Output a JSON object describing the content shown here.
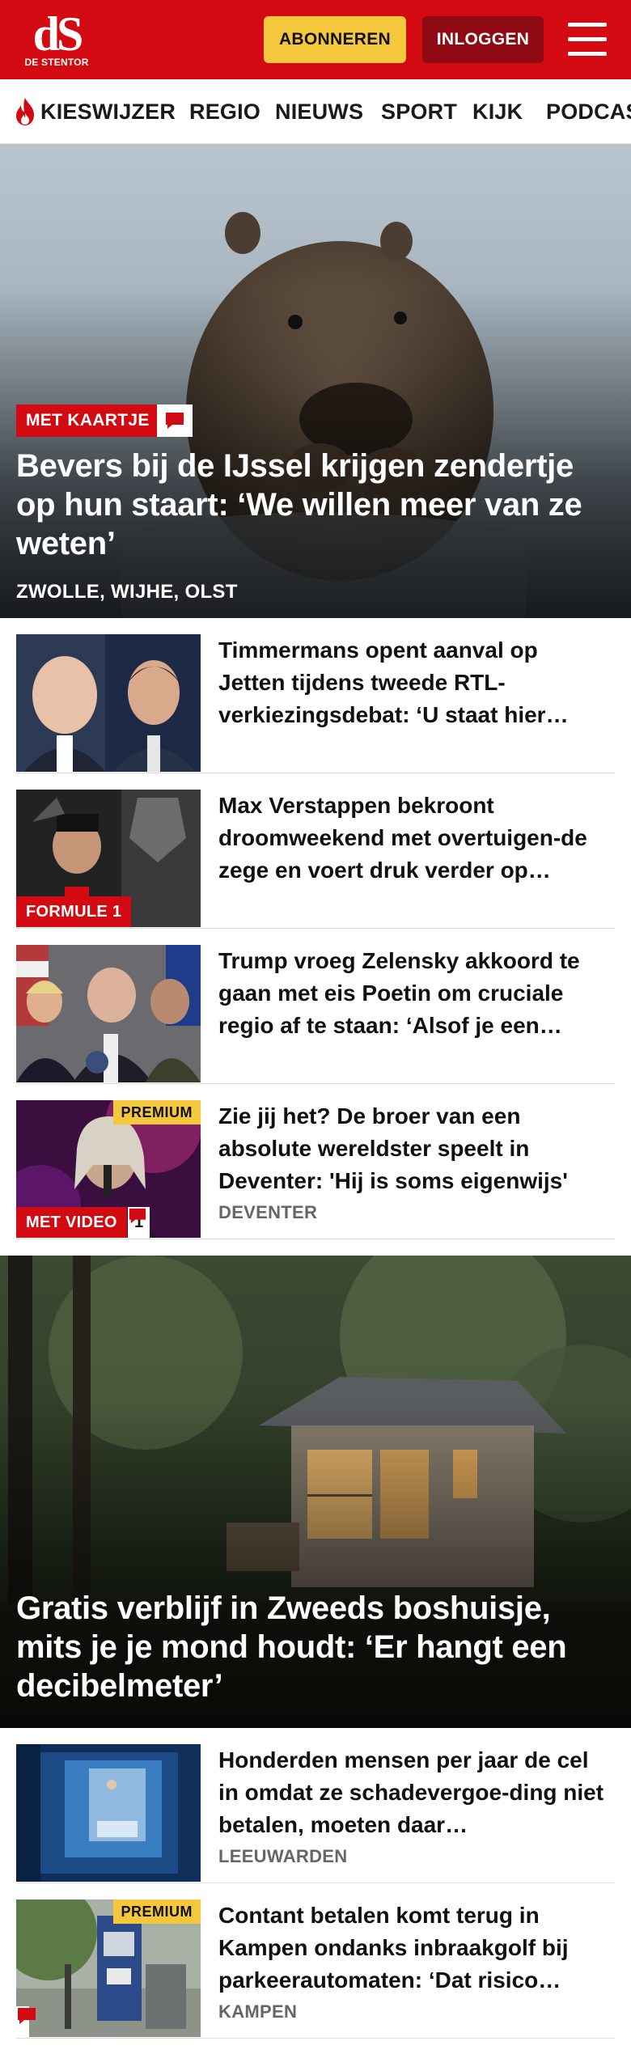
{
  "header": {
    "logo_mark": "dS",
    "logo_text": "DE STENTOR",
    "subscribe_label": "ABONNEREN",
    "login_label": "INLOGGEN",
    "menu_icon": "hamburger-menu-icon"
  },
  "nav": {
    "items": [
      {
        "label": "KIESWIJZER",
        "icon": "flame-icon"
      },
      {
        "label": "REGIO"
      },
      {
        "label": "NIEUWS"
      },
      {
        "label": "SPORT"
      },
      {
        "label": "KIJK"
      },
      {
        "label": "PODCAS"
      }
    ]
  },
  "hero1": {
    "tag": "MET KAARTJE",
    "comment_icon": "comment-icon",
    "title": "Bevers bij de IJssel krijgen zendertje op hun staart: ‘We willen meer van ze weten’",
    "location": "ZWOLLE, WIJHE, OLST"
  },
  "articles1": [
    {
      "title": "Timmermans opent aanval op Jetten tijdens tweede RTL-verkiezingsdebat: ‘U staat hier…"
    },
    {
      "title": "Max Verstappen bekroont droomweekend met overtuigen-de zege en voert druk verder op…",
      "tag": "FORMULE 1"
    },
    {
      "title": "Trump vroeg Zelensky akkoord te gaan met eis Poetin om cruciale regio af te staan: ‘Alsof je een…"
    },
    {
      "title": "Zie jij het? De broer van een absolute wereldster speelt in Deventer: 'Hij is soms eigenwijs'",
      "location": "DEVENTER",
      "premium": "PREMIUM",
      "tag": "MET VIDEO",
      "comment_count": "1"
    }
  ],
  "hero2": {
    "title": "Gratis verblijf in Zweeds boshuisje, mits je je mond houdt: ‘Er hangt een decibelmeter’"
  },
  "articles2": [
    {
      "title": "Honderden mensen per jaar de cel in omdat ze schadevergoe-ding niet betalen, moeten daar…",
      "location": "LEEUWARDEN"
    },
    {
      "title": "Contant betalen komt terug in Kampen ondanks inbraakgolf bij parkeerautomaten: ‘Dat risico…",
      "location": "KAMPEN",
      "premium": "PREMIUM"
    }
  ],
  "colors": {
    "brand_red": "#d30a11",
    "login_dark_red": "#8f0a12",
    "premium_yellow": "#f5c73c"
  }
}
